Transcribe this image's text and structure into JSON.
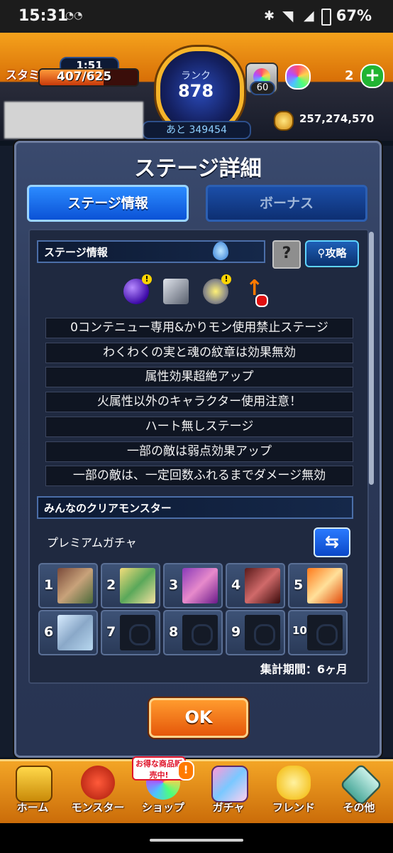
{
  "status": {
    "time": "15:31",
    "battery": "67%"
  },
  "header": {
    "stamina_label": "スタミナ",
    "stamina_timer": "1:51",
    "stamina_value": "407/625",
    "stamina_fraction": 0.651,
    "rank_label": "ランク",
    "rank_value": "878",
    "rank_remaining": "あと 349454",
    "orb_box_count": "60",
    "orb_count": "2",
    "gold": "257,274,570"
  },
  "dialog": {
    "title": "ステージ詳細",
    "tabs": [
      {
        "label": "ステージ情報",
        "active": true
      },
      {
        "label": "ボーナス",
        "active": false
      }
    ],
    "stage_info_heading": "ステージ情報",
    "strategy_button": "攻略",
    "rules": [
      "0コンテニュー専用&かりモン使用禁止ステージ",
      "わくわくの実と魂の紋章は効果無効",
      "属性効果超絶アップ",
      "火属性以外のキャラクター使用注意！",
      "ハート無しステージ",
      "一部の敵は弱点効果アップ",
      "一部の敵は、一定回数ふれるまでダメージ無効"
    ],
    "clear_heading": "みんなのクリアモンスター",
    "gacha_label": "プレミアムガチャ",
    "slots": [
      "1",
      "2",
      "3",
      "4",
      "5",
      "6",
      "7",
      "8",
      "9",
      "10"
    ],
    "period": "集計期間：6ヶ月",
    "ok_label": "OK"
  },
  "nav": {
    "items": [
      {
        "label": "ホーム"
      },
      {
        "label": "モンスター"
      },
      {
        "label": "ショップ",
        "badge": "お得な商品販売中!"
      },
      {
        "label": "ガチャ"
      },
      {
        "label": "フレンド"
      },
      {
        "label": "その他"
      }
    ]
  }
}
